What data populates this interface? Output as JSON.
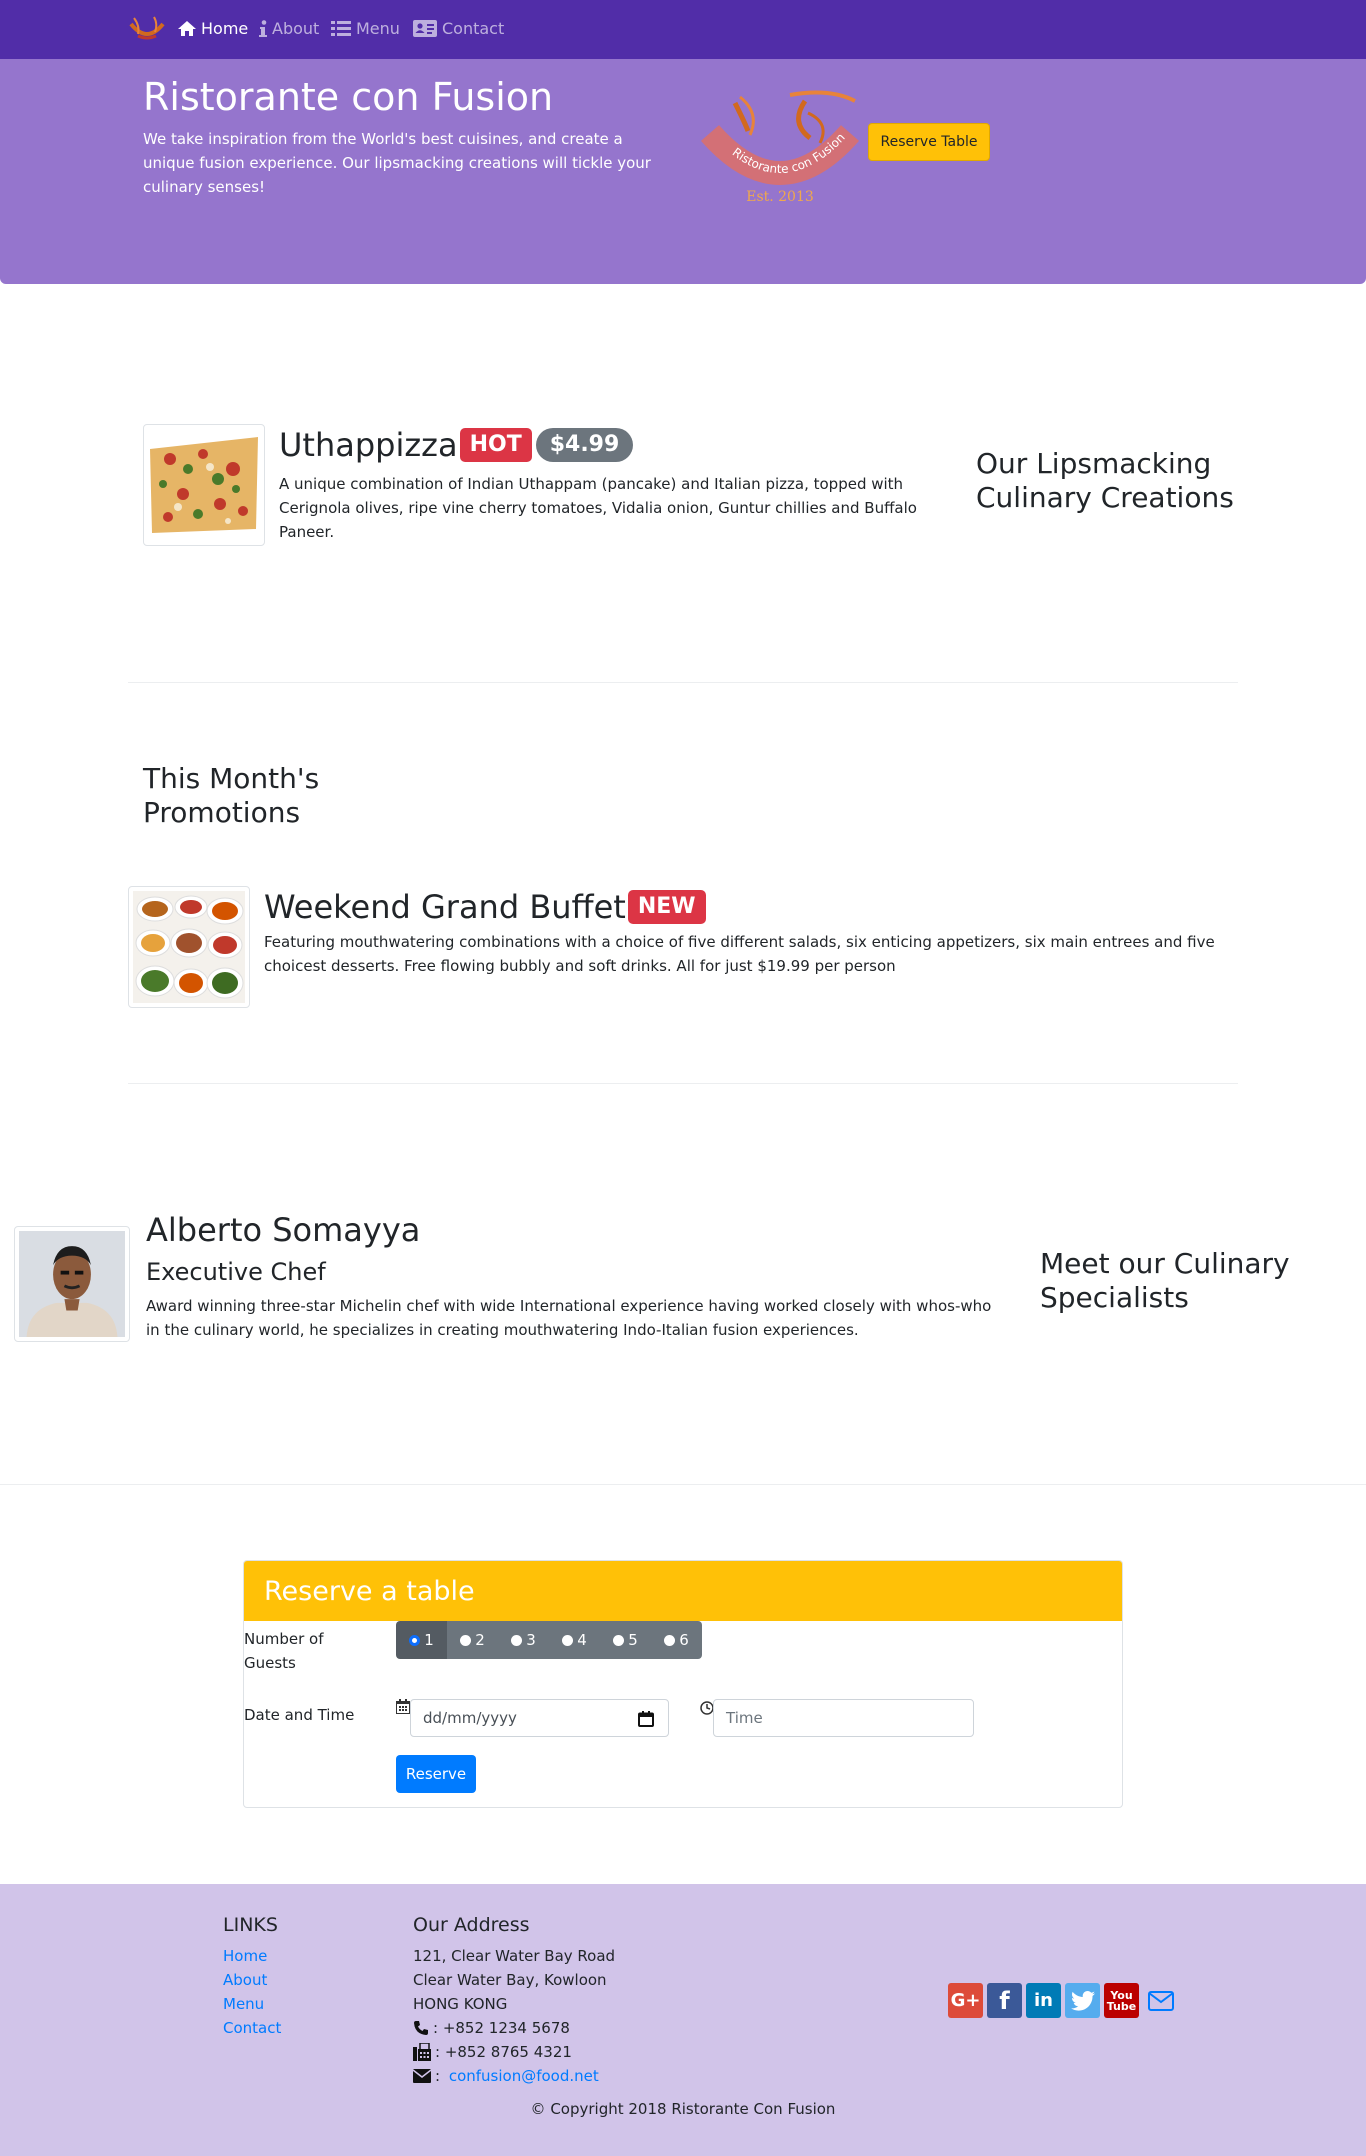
{
  "nav": {
    "items": [
      {
        "label": "Home",
        "icon": "home-icon"
      },
      {
        "label": "About",
        "icon": "info-icon"
      },
      {
        "label": "Menu",
        "icon": "list-icon"
      },
      {
        "label": "Contact",
        "icon": "address-card-icon"
      }
    ],
    "active": "Home"
  },
  "jumbotron": {
    "title": "Ristorante con Fusion",
    "text": "We take inspiration from the World's best cuisines, and create a unique fusion experience. Our lipsmacking creations will tickle your culinary senses!",
    "logo_text": "Ristorante con Fusion",
    "logo_est": "Est. 2013",
    "reserve_button": "Reserve Table"
  },
  "dish": {
    "name": "Uthappizza",
    "badge": "HOT",
    "price": "$4.99",
    "description": "A unique combination of Indian Uthappam (pancake) and Italian pizza, topped with Cerignola olives, ripe vine cherry tomatoes, Vidalia onion, Guntur chillies and Buffalo Paneer.",
    "side_heading": "Our Lipsmacking Culinary Creations"
  },
  "promotion": {
    "section_heading": "This Month's Promotions",
    "name": "Weekend Grand Buffet",
    "badge": "NEW",
    "description": "Featuring mouthwatering combinations with a choice of five different salads, six enticing appetizers, six main entrees and five choicest desserts. Free flowing bubbly and soft drinks. All for just $19.99 per person"
  },
  "leader": {
    "name": "Alberto Somayya",
    "designation": "Executive Chef",
    "description": "Award winning three-star Michelin chef with wide International experience having worked closely with whos-who in the culinary world, he specializes in creating mouthwatering Indo-Italian fusion experiences.",
    "side_heading": "Meet our Culinary Specialists"
  },
  "reservation": {
    "header": "Reserve a table",
    "guests_label": "Number of Guests",
    "guest_options": [
      "1",
      "2",
      "3",
      "4",
      "5",
      "6"
    ],
    "selected_guests": "1",
    "datetime_label": "Date and Time",
    "date_placeholder": "dd/mm/yyyy",
    "time_placeholder": "Time",
    "submit": "Reserve"
  },
  "footer": {
    "links_heading": "LINKS",
    "links": [
      "Home",
      "About",
      "Menu",
      "Contact"
    ],
    "address_heading": "Our Address",
    "address_lines": [
      "121, Clear Water Bay Road",
      "Clear Water Bay, Kowloon",
      "HONG KONG"
    ],
    "phone": ": +852 1234 5678",
    "fax": ": +852 8765 4321",
    "email": "confusion@food.net",
    "copyright": "© Copyright 2018 Ristorante Con Fusion",
    "social": [
      {
        "name": "google-plus",
        "color": "#dd4b39"
      },
      {
        "name": "facebook",
        "color": "#3b5998"
      },
      {
        "name": "linkedin",
        "color": "#007bb6"
      },
      {
        "name": "twitter",
        "color": "#55acee"
      },
      {
        "name": "youtube",
        "color": "#bb0000"
      },
      {
        "name": "mail",
        "color": "#007bff"
      }
    ]
  },
  "colors": {
    "navbar": "#512DA8",
    "jumbotron": "#9575CD",
    "footer": "#D1C4E9",
    "accent": "#FFC107"
  }
}
